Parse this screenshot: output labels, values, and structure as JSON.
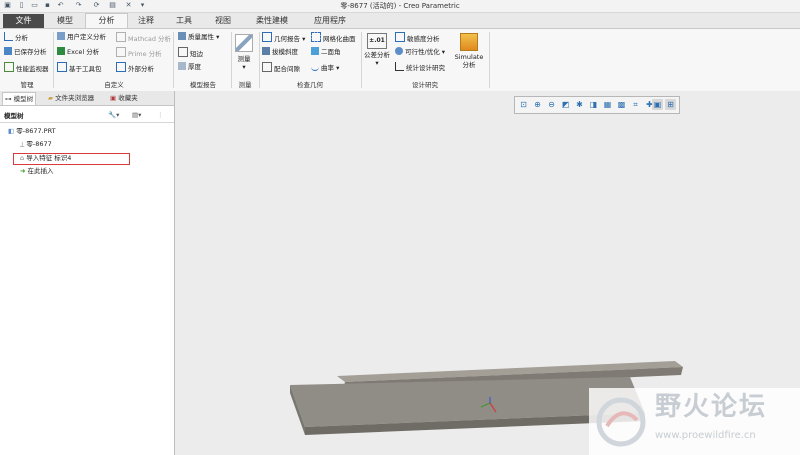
{
  "window": {
    "title": "零-8677 (活动的) - Creo Parametric"
  },
  "tabs": [
    "文件",
    "模型",
    "分析",
    "注释",
    "工具",
    "视图",
    "柔性建模",
    "应用程序"
  ],
  "ribbon": {
    "manage": {
      "items": [
        "分析",
        "已保存分析",
        "性能监视器"
      ],
      "label": "管理"
    },
    "custom": {
      "items": [
        "用户定义分析",
        "Excel 分析",
        "基于工具包",
        "Mathcad 分析",
        "Prime 分析",
        "外部分析"
      ],
      "label": "自定义"
    },
    "model_report": {
      "items": [
        "质量属性",
        "短边",
        "厚度"
      ],
      "label": "模型报告"
    },
    "measure": {
      "button": "测量",
      "label": "测量"
    },
    "inspect_geometry": {
      "items": [
        "几何报告",
        "网格化曲面",
        "拔模斜度",
        "二面角",
        "配合间隙",
        "曲率"
      ],
      "label": "检查几何"
    },
    "design_study": {
      "items": [
        "公差分析",
        "敏感度分析",
        "可行性/优化",
        "统计设计研究"
      ],
      "simulate": [
        "Simulate",
        "分析"
      ],
      "tol_icon": "±.01",
      "label": "设计研究"
    }
  },
  "panel": {
    "tabs": [
      "模型树",
      "文件夹浏览器",
      "收藏夹"
    ],
    "header": "模型树",
    "tree": [
      "零-8677.PRT",
      "零-8677",
      "导入特征 标识4",
      "在此插入"
    ]
  },
  "watermark": {
    "title": "野火论坛",
    "url": "www.proewildfire.cn"
  },
  "colors": {
    "file_tab": "#4a4a4a",
    "highlight_box": "#d93b3b",
    "part_surface": "#908d86",
    "insert_arrow": "#3a9a2a"
  }
}
